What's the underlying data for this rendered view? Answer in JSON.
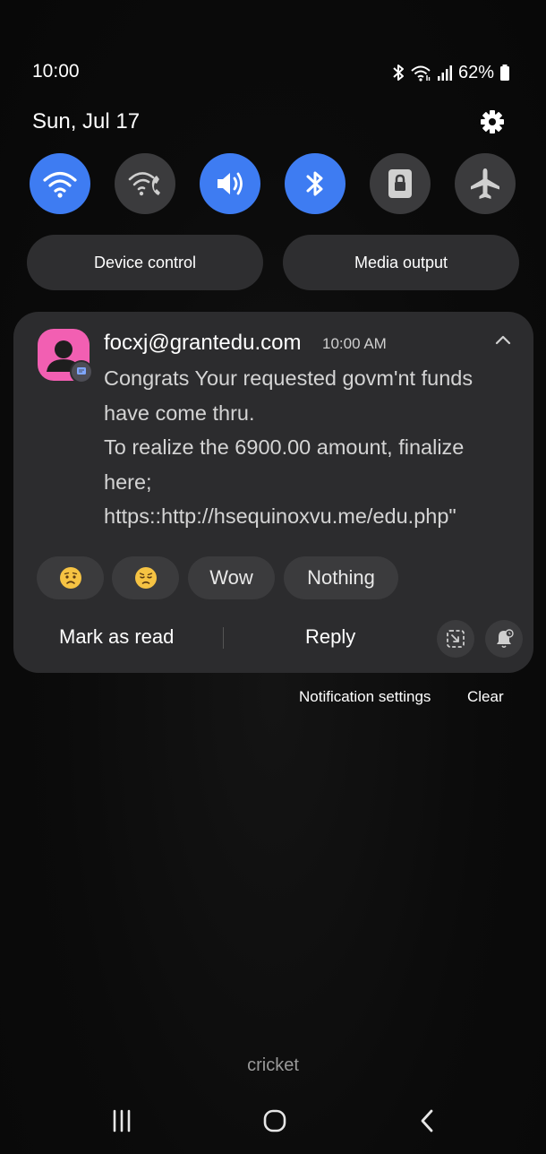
{
  "status_bar": {
    "time": "10:00",
    "battery": "62%",
    "icons": [
      "bluetooth-icon",
      "wifi-icon",
      "signal-icon",
      "battery-icon"
    ]
  },
  "header": {
    "date": "Sun, Jul 17",
    "settings_icon": "gear-icon"
  },
  "quick_settings": {
    "accent_color": "#3e7cf2",
    "tiles": [
      {
        "icon": "wifi-icon",
        "active": true
      },
      {
        "icon": "wifi-calling-icon",
        "active": false
      },
      {
        "icon": "sound-icon",
        "active": true
      },
      {
        "icon": "bluetooth-icon",
        "active": true
      },
      {
        "icon": "rotation-lock-icon",
        "active": false
      },
      {
        "icon": "airplane-mode-icon",
        "active": false
      }
    ],
    "device_control": "Device control",
    "media_output": "Media output"
  },
  "notification": {
    "avatar_color": "#f25fb2",
    "sender": "focxj@grantedu.com",
    "time": "10:00 AM",
    "lines": [
      "Congrats Your requested govm'nt funds",
      "have come thru.",
      "To realize the 6900.00 amount, finalize",
      "here;",
      "https::http://hsequinoxvu.me/edu.php\""
    ],
    "quick_replies": [
      {
        "type": "emoji",
        "icon": "worried-face-icon"
      },
      {
        "type": "emoji",
        "icon": "disappointed-face-icon"
      },
      {
        "type": "text",
        "label": "Wow"
      },
      {
        "type": "text",
        "label": "Nothing"
      }
    ],
    "actions": {
      "mark_as_read": "Mark as read",
      "reply": "Reply"
    }
  },
  "footer_links": {
    "settings": "Notification settings",
    "clear": "Clear"
  },
  "carrier": "cricket",
  "nav_bar": [
    "recent-apps-icon",
    "home-icon",
    "back-icon"
  ]
}
